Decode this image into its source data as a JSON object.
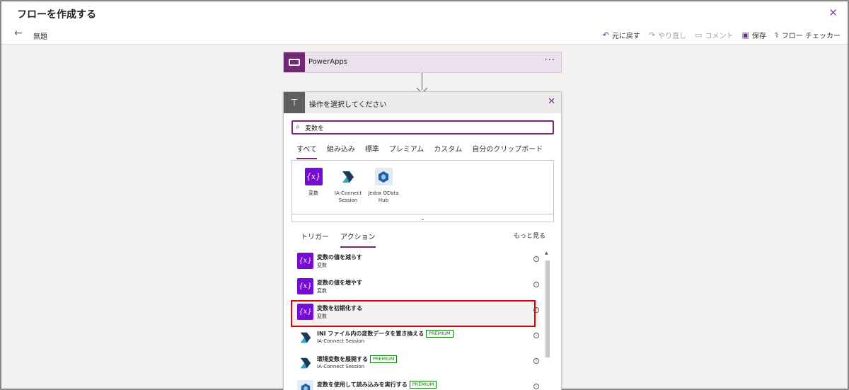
{
  "window": {
    "title": "フローを作成する",
    "close_icon": "close-icon"
  },
  "commandbar": {
    "flow_name": "無題",
    "undo": "元に戻す",
    "redo": "やり直し",
    "comment": "コメント",
    "save": "保存",
    "checker": "フロー チェッカー"
  },
  "trigger": {
    "label": "PowerApps",
    "more": "···"
  },
  "panel": {
    "title": "操作を選択してください",
    "search_value": "変数を",
    "tabs": [
      "すべて",
      "組み込み",
      "標準",
      "プレミアム",
      "カスタム",
      "自分のクリップボード"
    ],
    "active_tab": "すべて",
    "connectors": [
      {
        "line1": "変数",
        "line2": "",
        "icon": "variable-icon"
      },
      {
        "line1": "IA-Connect",
        "line2": "Session",
        "icon": "ia-connect-icon"
      },
      {
        "line1": "Jedox OData",
        "line2": "Hub",
        "icon": "jedox-icon"
      }
    ],
    "subtabs": [
      "トリガー",
      "アクション"
    ],
    "active_subtab": "アクション",
    "see_more": "もっと見る",
    "actions": [
      {
        "name": "変数の値を減らす",
        "connector": "変数",
        "premium": ""
      },
      {
        "name": "変数の値を増やす",
        "connector": "変数",
        "premium": ""
      },
      {
        "name": "変数を初期化する",
        "connector": "変数",
        "premium": ""
      },
      {
        "name": "INI ファイル内の変数データを置き換える",
        "connector": "IA-Connect Session",
        "premium": "PREMIUM"
      },
      {
        "name": "環境変数を展開する",
        "connector": "IA-Connect Session",
        "premium": "PREMIUM"
      },
      {
        "name": "変数を使用して読み込みを実行する",
        "connector": "",
        "premium": "PREMIUM"
      }
    ],
    "selected_action": "変数を初期化する"
  },
  "colors": {
    "accent": "#742774",
    "variable_icon": "#770bd6",
    "premium": "#107c10",
    "highlight": "#e0000b"
  }
}
